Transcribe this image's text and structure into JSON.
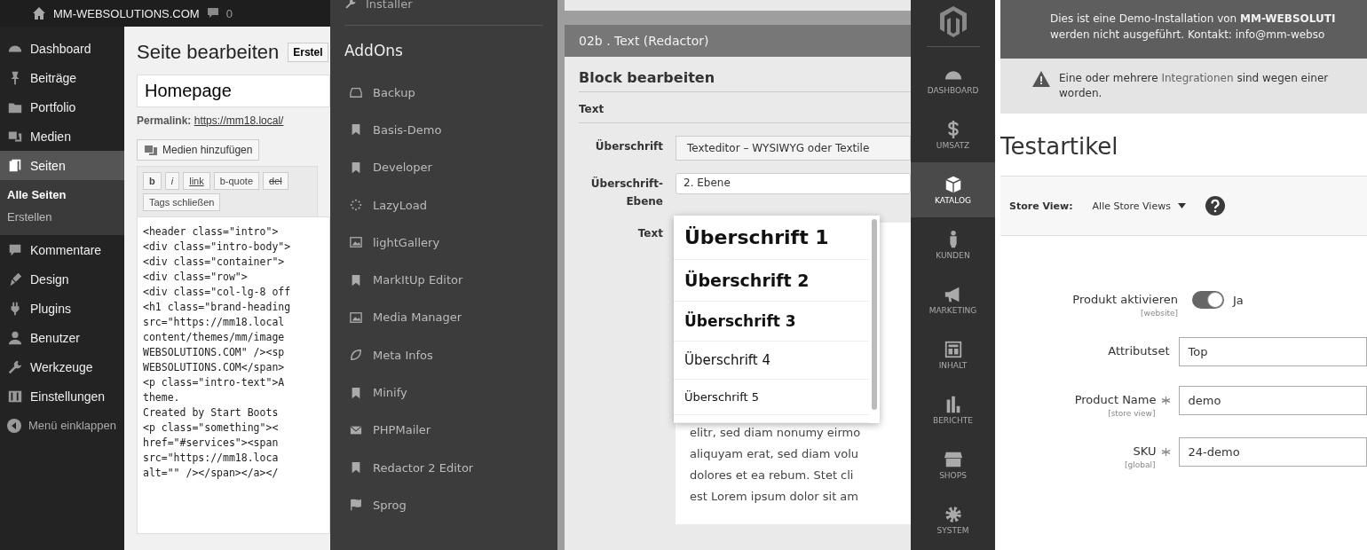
{
  "wp": {
    "site_name": "MM-WEBSOLUTIONS.COM",
    "comment_count": "0",
    "menu": [
      {
        "label": "Dashboard",
        "selected": false
      },
      {
        "label": "Beiträge",
        "selected": false
      },
      {
        "label": "Portfolio",
        "selected": false
      },
      {
        "label": "Medien",
        "selected": false
      },
      {
        "label": "Seiten",
        "selected": true
      },
      {
        "label": "Kommentare",
        "selected": false
      },
      {
        "label": "Design",
        "selected": false
      },
      {
        "label": "Plugins",
        "selected": false
      },
      {
        "label": "Benutzer",
        "selected": false
      },
      {
        "label": "Werkzeuge",
        "selected": false
      },
      {
        "label": "Einstellungen",
        "selected": false
      }
    ],
    "submenu": [
      {
        "label": "Alle Seiten",
        "selected": true
      },
      {
        "label": "Erstellen",
        "selected": false
      }
    ],
    "collapse": "Menü einklappen",
    "heading": "Seite bearbeiten",
    "new_button": "Erstel",
    "title_value": "Homepage",
    "permalink_label": "Permalink:",
    "permalink": "https://mm18.local/",
    "media_button": "Medien hinzufügen",
    "quicktags": [
      {
        "label": "b",
        "kind": "bold"
      },
      {
        "label": "i",
        "kind": "italic"
      },
      {
        "label": "link",
        "kind": "link"
      },
      {
        "label": "b-quote",
        "kind": "plain"
      },
      {
        "label": "del",
        "kind": "strike"
      },
      {
        "label": "Tags schließen",
        "kind": "plain"
      }
    ],
    "code_lines": [
      "<header class=\"intro\">",
      "<div class=\"intro-body\">",
      "<div class=\"container\">",
      "<div class=\"row\">",
      "<div class=\"col-lg-8 off",
      "<h1 class=\"brand-heading",
      "src=\"https://mm18.local",
      "content/themes/mm/image",
      "WEBSOLUTIONS.COM\" /><sp",
      "WEBSOLUTIONS.COM</span>",
      "<p class=\"intro-text\">A",
      "theme.",
      "Created by Start Boots",
      "<p class=\"something\"><",
      "href=\"#services\"><span",
      "src=\"https://mm18.loca",
      "alt=\"\" /></span></a></"
    ]
  },
  "redaxo": {
    "installer": "Installer",
    "section": "AddOns",
    "addons": [
      {
        "label": "Backup"
      },
      {
        "label": "Basis-Demo"
      },
      {
        "label": "Developer"
      },
      {
        "label": "LazyLoad"
      },
      {
        "label": "lightGallery"
      },
      {
        "label": "MarkItUp Editor"
      },
      {
        "label": "Media Manager"
      },
      {
        "label": "Meta Infos"
      },
      {
        "label": "Minify"
      },
      {
        "label": "PHPMailer"
      },
      {
        "label": "Redactor 2 Editor"
      },
      {
        "label": "Sprog"
      }
    ]
  },
  "block": {
    "header": "02b . Text (Redactor)",
    "title": "Block bearbeiten",
    "section": "Text",
    "fields": [
      {
        "label": "Überschrift",
        "value": "Texteditor – WYSIWYG oder Textile",
        "kind": "select"
      },
      {
        "label": "Überschrift-Ebene",
        "value": "2. Ebene",
        "kind": "input"
      }
    ],
    "text_label": "Text",
    "heading_options": [
      {
        "label": "Überschrift 1",
        "kind": "h1"
      },
      {
        "label": "Überschrift 2",
        "kind": "h2"
      },
      {
        "label": "Überschrift 3",
        "kind": "h3"
      },
      {
        "label": "Überschrift 4",
        "kind": "h4"
      },
      {
        "label": "Überschrift 5",
        "kind": "h5"
      }
    ],
    "body_lines": [
      "elitr, sed diam nonumy eirmo",
      "aliquyam erat, sed diam volu",
      "dolores et ea rebum. Stet cli",
      "est Lorem ipsum dolor sit am"
    ]
  },
  "magento_nav": [
    {
      "label": "DASHBOARD",
      "selected": false
    },
    {
      "label": "UMSATZ",
      "selected": false
    },
    {
      "label": "KATALOG",
      "selected": true
    },
    {
      "label": "KUNDEN",
      "selected": false
    },
    {
      "label": "MARKETING",
      "selected": false
    },
    {
      "label": "INHALT",
      "selected": false
    },
    {
      "label": "BERICHTE",
      "selected": false
    },
    {
      "label": "SHOPS",
      "selected": false
    },
    {
      "label": "SYSTEM",
      "selected": false
    }
  ],
  "magento": {
    "notice": "Dies ist eine Demo-Installation von **MM-WEBSOLUTI**",
    "notice_2": "werden nicht ausgeführt. Kontakt: info@mm-webso",
    "warning_before": "Eine oder mehrere",
    "warning_link": "Integrationen",
    "warning_after": "sind wegen einer",
    "warning_2": "worden.",
    "page_title": "Testartikel",
    "store_view_label": "Store View:",
    "store_view_value": "Alle Store Views",
    "form": [
      {
        "label": "Produkt aktivieren",
        "scope": "[website]",
        "required": false,
        "kind": "toggle",
        "on": true,
        "value": "Ja"
      },
      {
        "label": "Attributset",
        "required": false,
        "kind": "input",
        "value": "Top"
      },
      {
        "label": "Product Name",
        "scope": "[store view]",
        "required": true,
        "kind": "input",
        "value": "demo"
      },
      {
        "label": "SKU",
        "scope": "[global]",
        "required": true,
        "kind": "input",
        "value": "24-demo"
      }
    ]
  }
}
